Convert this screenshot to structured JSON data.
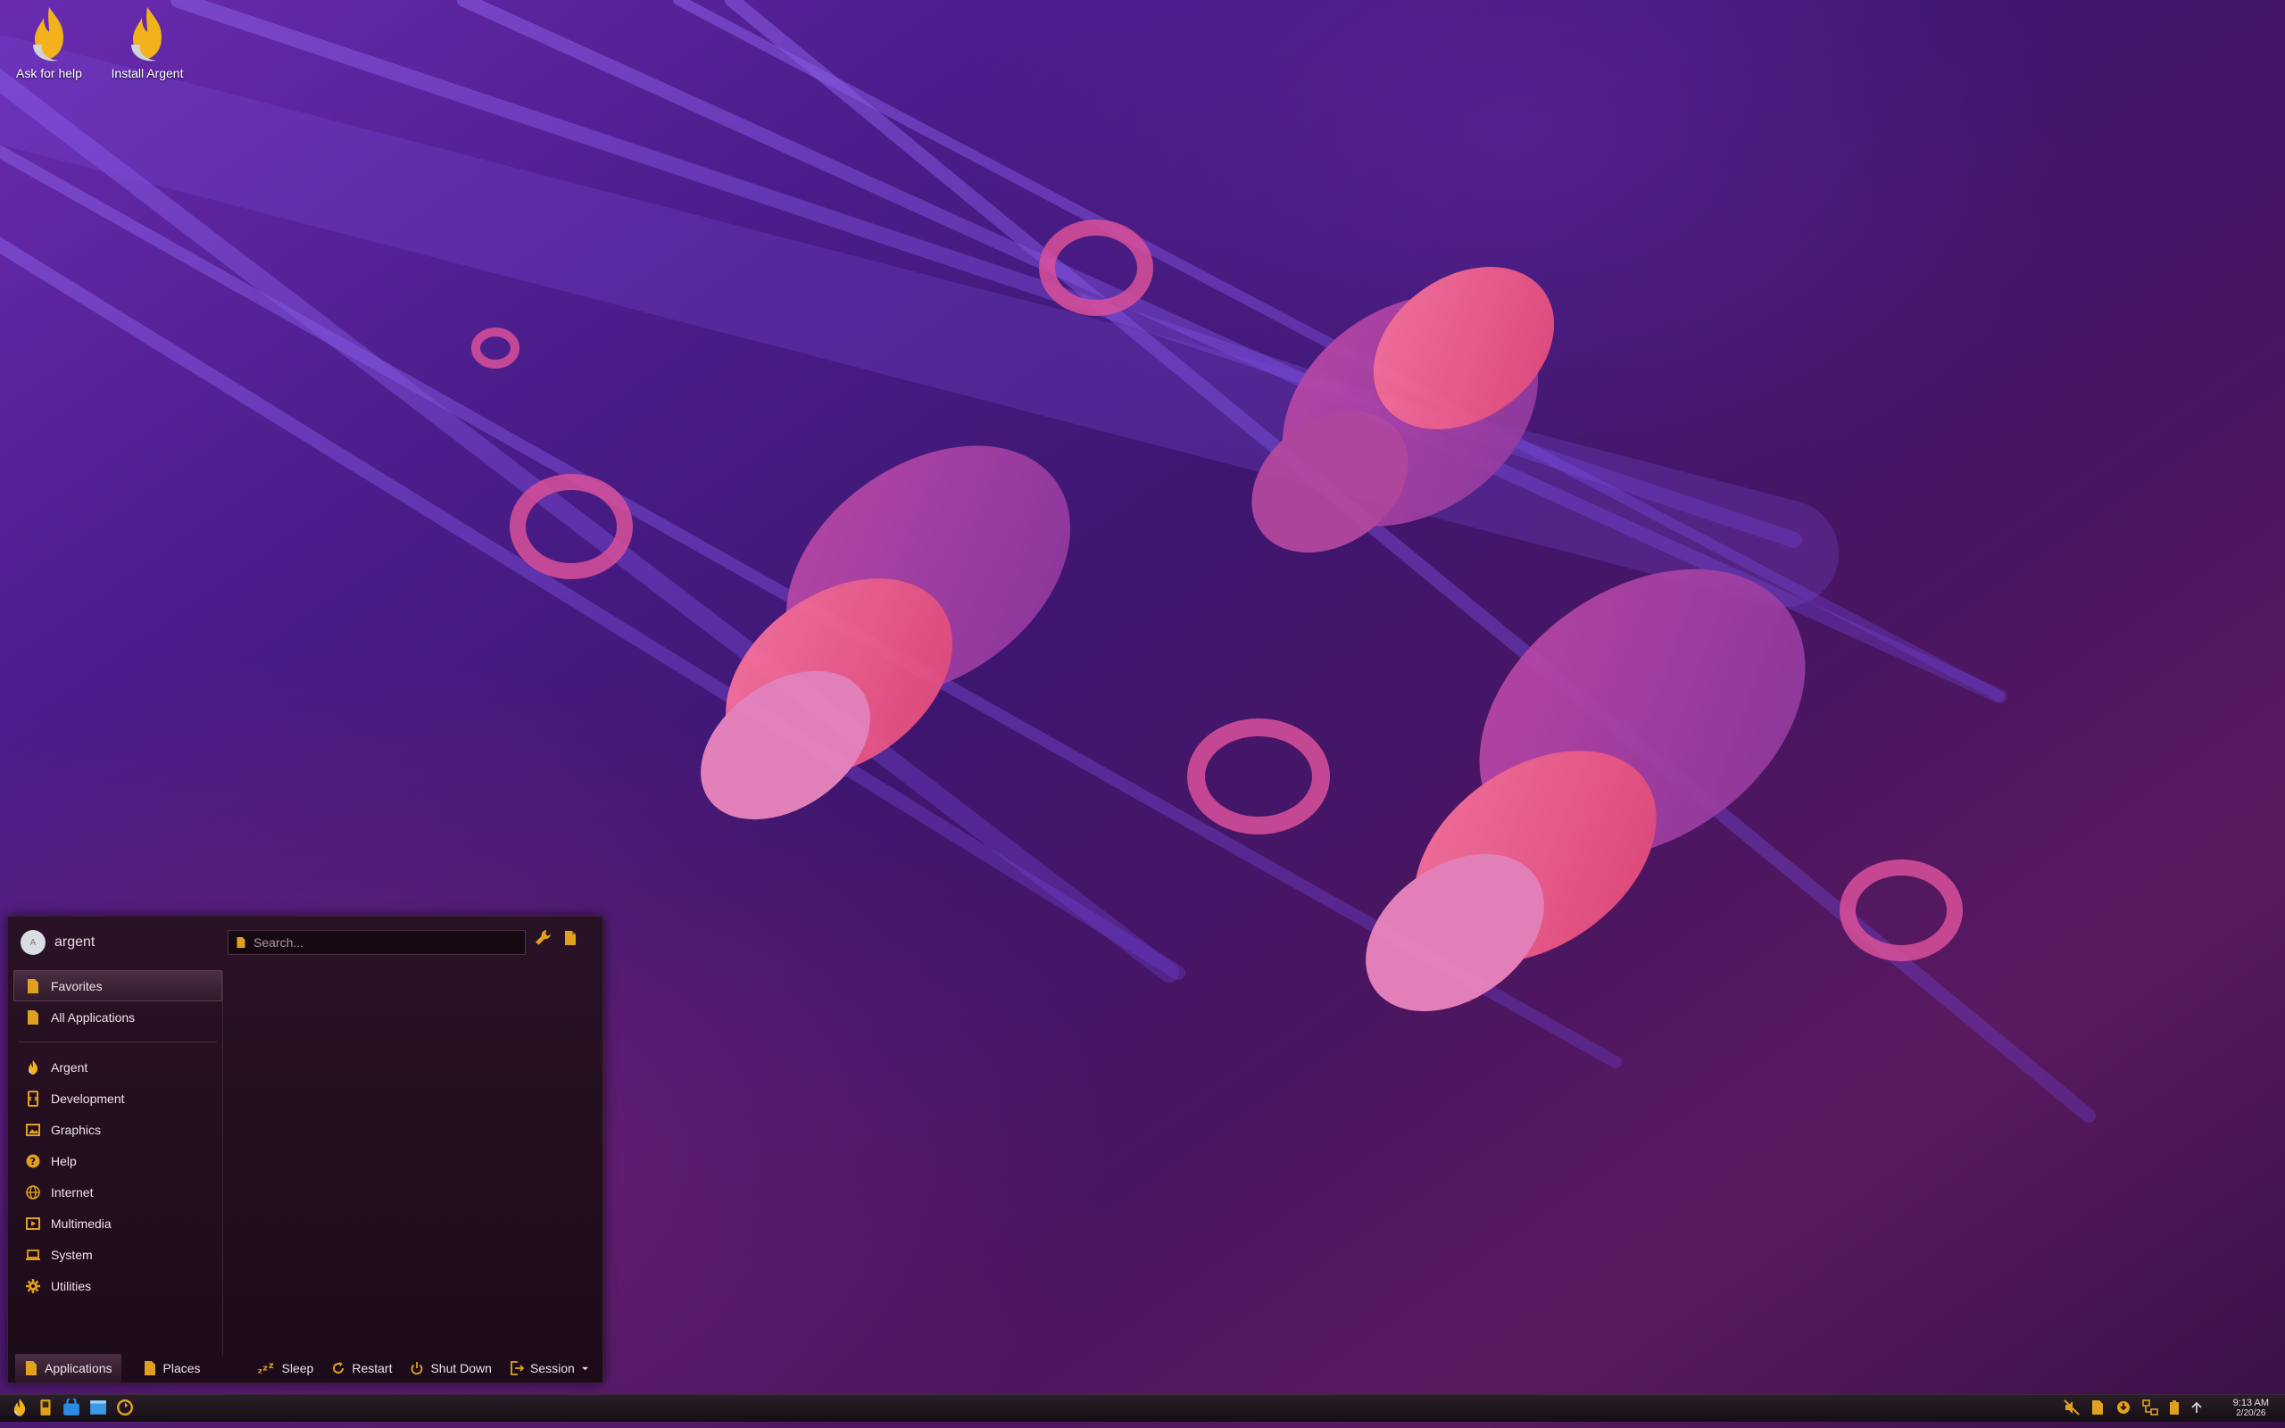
{
  "desktop": {
    "icons": [
      {
        "label": "Ask for help"
      },
      {
        "label": "Install Argent"
      }
    ]
  },
  "start_menu": {
    "user": {
      "avatar_initial": "A",
      "name": "argent"
    },
    "search": {
      "placeholder": "Search..."
    },
    "categories_top": [
      {
        "label": "Favorites",
        "active": true
      },
      {
        "label": "All Applications"
      }
    ],
    "categories": [
      {
        "label": "Argent",
        "icon": "flame-icon"
      },
      {
        "label": "Development",
        "icon": "development-icon"
      },
      {
        "label": "Graphics",
        "icon": "graphics-icon"
      },
      {
        "label": "Help",
        "icon": "help-icon"
      },
      {
        "label": "Internet",
        "icon": "globe-icon"
      },
      {
        "label": "Multimedia",
        "icon": "multimedia-icon"
      },
      {
        "label": "System",
        "icon": "laptop-icon"
      },
      {
        "label": "Utilities",
        "icon": "gear-icon"
      }
    ],
    "bottom": {
      "applications": "Applications",
      "places": "Places",
      "sleep": "Sleep",
      "restart": "Restart",
      "shutdown": "Shut Down",
      "session": "Session"
    }
  },
  "taskbar": {
    "clock": {
      "time": "9:13 AM",
      "date": "2/20/26"
    }
  },
  "colors": {
    "accent": "#e0a020",
    "menu_bg": "#1c0b19"
  }
}
